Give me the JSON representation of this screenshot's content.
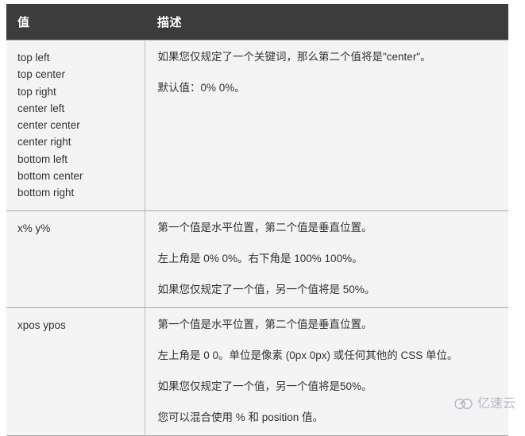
{
  "table": {
    "headers": {
      "value": "值",
      "description": "描述"
    },
    "rows": [
      {
        "value_items": [
          "top left",
          "top center",
          "top right",
          "center left",
          "center center",
          "center right",
          "bottom left",
          "bottom center",
          "bottom right"
        ],
        "description_paragraphs": [
          "如果您仅规定了一个关键词，那么第二个值将是\"center\"。",
          "默认值：0% 0%。"
        ]
      },
      {
        "value_items": [
          "x% y%"
        ],
        "description_paragraphs": [
          "第一个值是水平位置，第二个值是垂直位置。",
          "左上角是 0% 0%。右下角是 100% 100%。",
          "如果您仅规定了一个值，另一个值将是 50%。"
        ]
      },
      {
        "value_items": [
          "xpos ypos"
        ],
        "description_paragraphs": [
          "第一个值是水平位置，第二个值是垂直位置。",
          "左上角是 0 0。单位是像素 (0px 0px) 或任何其他的 CSS 单位。",
          "如果您仅规定了一个值，另一个值将是50%。",
          "您可以混合使用 % 和 position 值。"
        ]
      }
    ]
  },
  "watermark": {
    "text": "亿速云",
    "icon": "cloud-logo-icon",
    "color": "#8f96ae"
  },
  "colors": {
    "header_background": "#3c3c3c",
    "header_text": "#ffffff",
    "cell_background": "#f4f4f4",
    "cell_text": "#333333",
    "border": "#aaaaaa",
    "page_background": "#ffffff"
  }
}
